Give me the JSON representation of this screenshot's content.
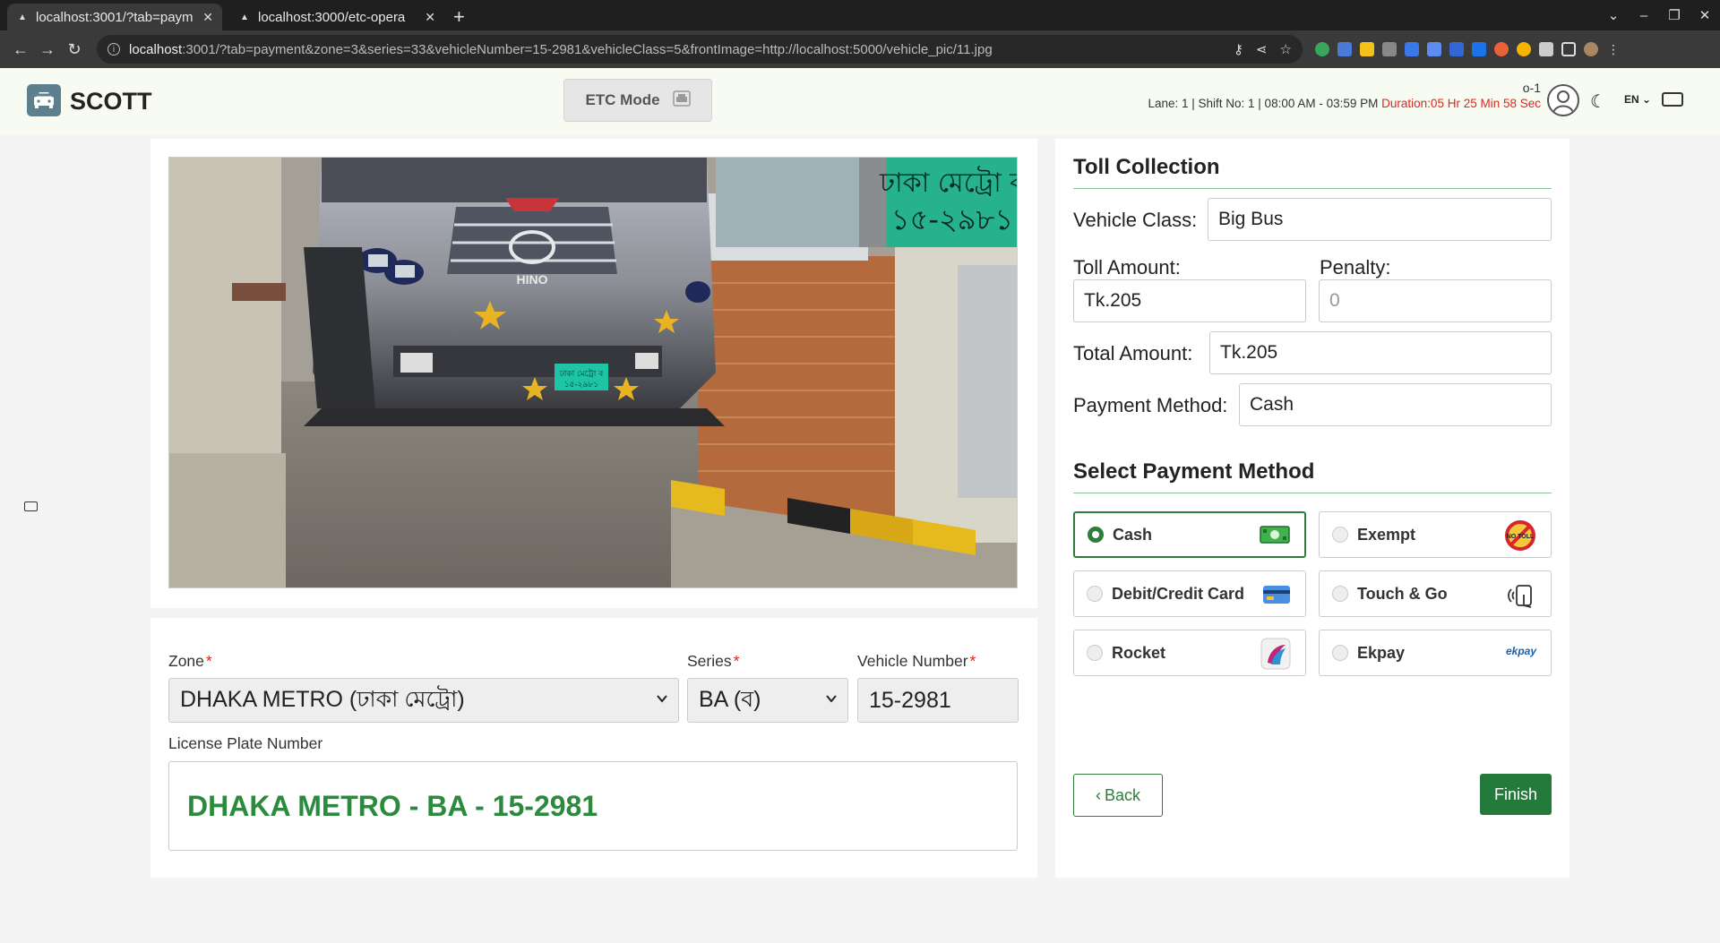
{
  "browser": {
    "tabs": [
      {
        "title": "localhost:3001/?tab=paym",
        "active": true
      },
      {
        "title": "localhost:3000/etc-opera",
        "active": false
      }
    ],
    "url_host": "localhost",
    "url_rest": ":3001/?tab=payment&zone=3&series=33&vehicleNumber=15-2981&vehicleClass=5&frontImage=http://localhost:5000/vehicle_pic/11.jpg"
  },
  "header": {
    "brand": "SCOTT",
    "etc_mode_label": "ETC Mode",
    "operator": "o-1",
    "shift_info": "Lane: 1 |  Shift No: 1 | 08:00 AM - 03:59 PM",
    "duration": "Duration:05 Hr 25 Min 58 Sec",
    "language": "EN"
  },
  "camera": {
    "plate_line1": "ঢাকা মেট্রো ব",
    "plate_line2": "১৫-২৯৮১",
    "bus_brand": "HINO"
  },
  "form": {
    "zone_label": "Zone",
    "zone_value": "DHAKA METRO (ঢাকা মেট্রো)",
    "series_label": "Series",
    "series_value": "BA (ব)",
    "vehicle_number_label": "Vehicle Number",
    "vehicle_number_value": "15-2981",
    "plate_label": "License Plate Number",
    "plate_value": "DHAKA METRO - BA - 15-2981"
  },
  "toll": {
    "title": "Toll Collection",
    "vehicle_class_label": "Vehicle Class:",
    "vehicle_class_value": "Big Bus",
    "toll_amount_label": "Toll Amount:",
    "toll_amount_value": "Tk.205",
    "penalty_label": "Penalty:",
    "penalty_value": "0",
    "total_amount_label": "Total Amount:",
    "total_amount_value": "Tk.205",
    "payment_method_label": "Payment Method:",
    "payment_method_value": "Cash"
  },
  "payment": {
    "title": "Select Payment Method",
    "methods": [
      {
        "label": "Cash",
        "selected": true
      },
      {
        "label": "Exempt",
        "selected": false
      },
      {
        "label": "Debit/Credit Card",
        "selected": false
      },
      {
        "label": "Touch & Go",
        "selected": false
      },
      {
        "label": "Rocket",
        "selected": false
      },
      {
        "label": "Ekpay",
        "selected": false
      }
    ],
    "exempt_icon_text": "NO TOLL",
    "ekpay_icon_text": "ekpay",
    "back_label": "Back",
    "finish_label": "Finish"
  },
  "colors": {
    "accent_green": "#2f7d3b",
    "duration_red": "#e0261c",
    "plate_green": "#2b8a3e"
  }
}
